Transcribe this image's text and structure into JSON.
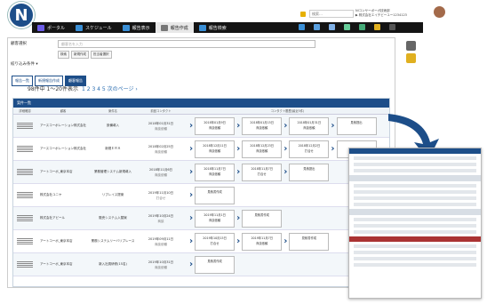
{
  "app": {
    "logo_letter": "N"
  },
  "nav": {
    "items": [
      {
        "label": "ポータル",
        "icon": "portal-icon",
        "color": "#6c5ce7"
      },
      {
        "label": "スケジュール",
        "icon": "schedule-icon",
        "color": "#3a8fd6"
      },
      {
        "label": "報告表示",
        "icon": "report-view-icon",
        "color": "#3a8fd6"
      },
      {
        "label": "報告作成",
        "icon": "report-create-icon",
        "color": "#777",
        "active": true
      },
      {
        "label": "報告検索",
        "icon": "report-search-icon",
        "color": "#3a8fd6"
      }
    ]
  },
  "header": {
    "search_placeholder": "検索…",
    "user_line1": "NIコンサーボーガ技術部",
    "user_line2": "▶ 株式会社エイチビーユー1234123"
  },
  "search": {
    "label": "顧客選択",
    "placeholder": "顧客名を入力",
    "conditions": [
      "検索",
      "新規作成",
      "担当者選択"
    ],
    "filter_label": "絞り込み条件 ▾"
  },
  "tabs": [
    "報告一覧",
    "新規報告作成",
    "顧客報告"
  ],
  "list": {
    "count_text": "98件中 1〜20件表示",
    "pages": "1 2 3 4 5  次のページ ›",
    "panel_title": "案件一覧",
    "columns": [
      "詳細確認",
      "顧客",
      "案件名",
      "前回コンタクト",
      "コンタクト履歴(最近5件)"
    ],
    "rows": [
      {
        "name": "アースコーポレーション株式会社",
        "product": "設備導入",
        "date": "2018年01月31日",
        "user": "商談依頼",
        "steps": [
          "2018年01月9日",
          "2018年01月15日",
          "2018年01月31日"
        ],
        "step_status": [
          "商談依頼",
          "商談依頼",
          "商談依頼"
        ],
        "next": "見積提出"
      },
      {
        "name": "アースコーポレーション株式会社",
        "product": "新規ＥＲＡ",
        "date": "2018年02月25日",
        "user": "商談依頼",
        "steps": [
          "2018年12月11日",
          "2018年12月23日",
          "2018年12月2日"
        ],
        "step_status": [
          "商談依頼",
          "商談依頼",
          "打合せ"
        ],
        "next": ""
      },
      {
        "name": "アートコーポ_東京本店",
        "product": "業務管理システム新規導入",
        "date": "2018年11月6日",
        "user": "商談依頼",
        "steps": [
          "2018年11月7日",
          "2018年11月7日"
        ],
        "step_status": [
          "商談依頼",
          "打合せ"
        ],
        "next": "見積提出"
      },
      {
        "name": "株式会社ユニヤ",
        "product": "リプレイス提案",
        "date": "2019年11月10日",
        "user": "打合せ",
        "steps": [],
        "step_status": [],
        "next": "見積書作成"
      },
      {
        "name": "株式会社アビール",
        "product": "販売システム入替案",
        "date": "2019年10月24日",
        "user": "商談",
        "steps": [
          "2019年11月1日"
        ],
        "step_status": [
          "商談依頼"
        ],
        "next": "見積書作成"
      },
      {
        "name": "アートコーポ_東京本店",
        "product": "業務システムリーバリプレース",
        "date": "2019年09月11日",
        "user": "商談依頼",
        "steps": [
          "2019年10月15日",
          "2019年11月7日"
        ],
        "step_status": [
          "打合せ",
          "商談依頼"
        ],
        "next": "見積書作成"
      },
      {
        "name": "アートコーポ_東京本店",
        "product": "新入社員研修(15名)",
        "date": "2019年10月31日",
        "user": "商談依頼",
        "steps": [],
        "step_status": [],
        "next": "見積書作成"
      }
    ]
  },
  "side": {
    "icons": [
      "settings-icon",
      "favorite-icon"
    ]
  },
  "preview": {
    "title": "案件詳細"
  }
}
